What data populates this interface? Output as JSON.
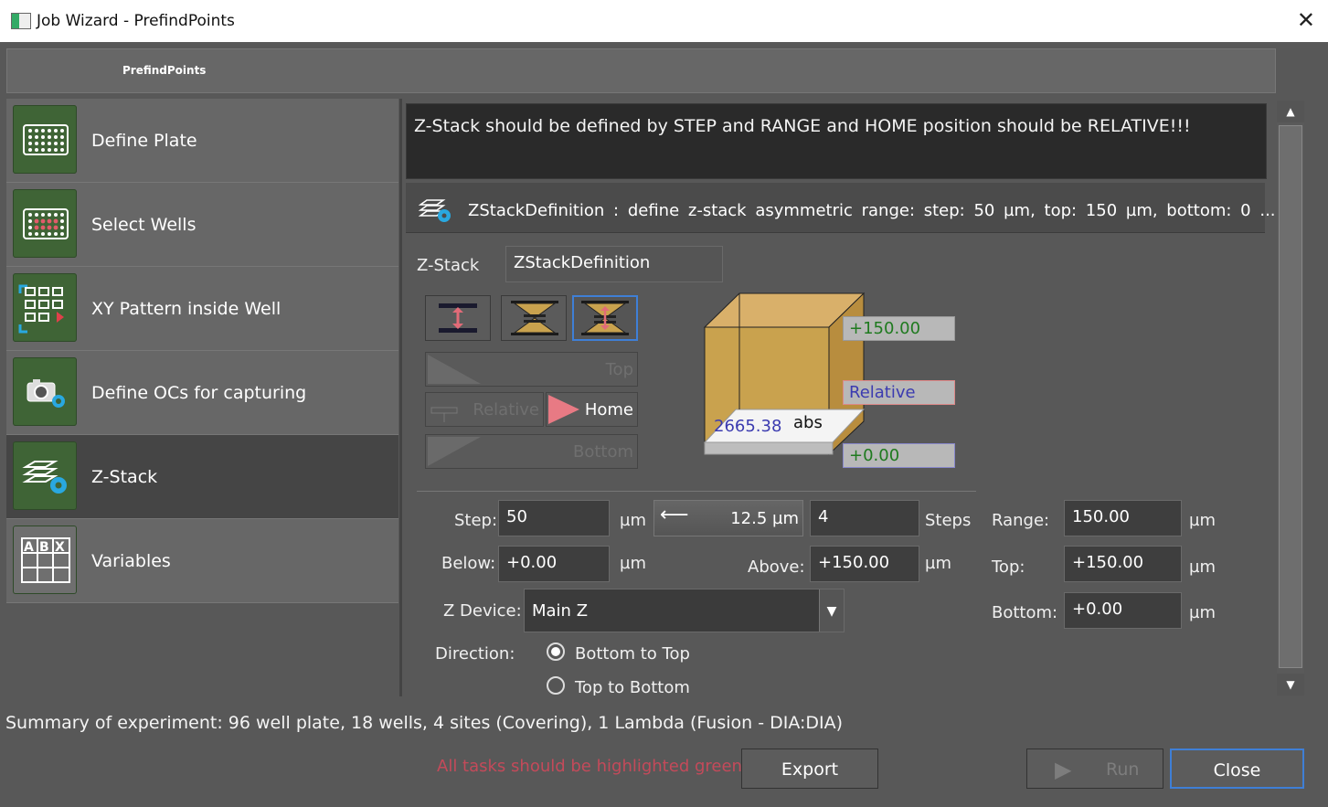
{
  "window": {
    "title": "Job Wizard - PrefindPoints",
    "close_glyph": "✕"
  },
  "header": {
    "title": "PrefindPoints"
  },
  "sidebar": {
    "items": [
      {
        "label": "Define Plate",
        "icon": "plate-grid-icon"
      },
      {
        "label": "Select Wells",
        "icon": "select-wells-icon"
      },
      {
        "label": "XY Pattern inside Well",
        "icon": "xy-pattern-icon"
      },
      {
        "label": "Define OCs for capturing",
        "icon": "camera-gear-icon"
      },
      {
        "label": "Z-Stack",
        "icon": "zstack-gear-icon",
        "active": true
      },
      {
        "label": "Variables",
        "icon": "variables-table-icon"
      }
    ]
  },
  "notice": {
    "text": "Z-Stack should be defined by STEP and RANGE and HOME position should be RELATIVE!!!"
  },
  "zstack": {
    "summary": "ZStackDefinition  :  define  z-stack  asymmetric  range:  step:  50  µm,  top:  150  µm,  bottom:  0  ...",
    "name_label": "Z-Stack",
    "name_value": "ZStackDefinition",
    "top_btn": "Top",
    "relative_btn": "Relative",
    "home_btn": "Home",
    "bottom_btn": "Bottom",
    "cube": {
      "top": "+150.00",
      "relative": "Relative",
      "bottom": "+0.00",
      "abs_value": "2665.38",
      "abs_label": "abs"
    },
    "step_label": "Step:",
    "step_value": "50",
    "unit": "µm",
    "step_size": "12.5 µm",
    "steps_value": "4",
    "steps_label": "Steps",
    "range_label": "Range:",
    "range_value": "150.00",
    "below_label": "Below:",
    "below_value": "+0.00",
    "above_label": "Above:",
    "above_value": "+150.00",
    "top_label": "Top:",
    "top_value": "+150.00",
    "bottom_label": "Bottom:",
    "bottom_value": "+0.00",
    "zdevice_label": "Z Device:",
    "zdevice_value": "Main Z",
    "direction_label": "Direction:",
    "direction_options": [
      "Bottom to Top",
      "Top to Bottom"
    ],
    "direction_selected": "Bottom to Top"
  },
  "footer": {
    "summary": "Summary of experiment: 96 well plate, 18 wells, 4 sites (Covering), 1 Lambda (Fusion - DIA:DIA)",
    "warning": "All tasks should be highlighted green.",
    "export": "Export",
    "run": "Run",
    "close": "Close"
  },
  "colors": {
    "accent": "#3f7fd6",
    "tile_green": "#3f6436",
    "warning": "#c44a5a",
    "cube": "#c9a24e",
    "cube_text_green": "#1f7a1f",
    "cube_text_blue": "#3b3bb0"
  }
}
